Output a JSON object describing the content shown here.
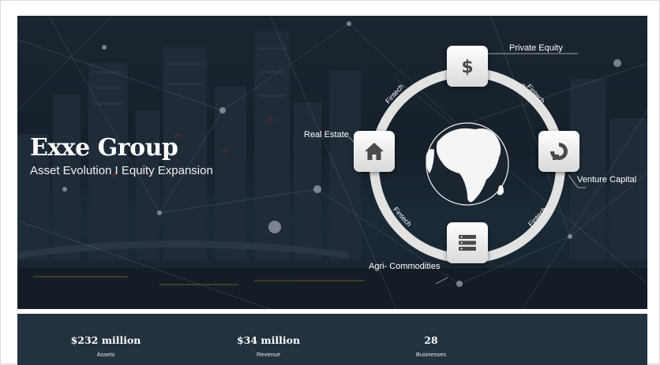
{
  "hero": {
    "title": "Exxe Group",
    "subtitle": "Asset Evolution I Equity Expansion"
  },
  "diagram": {
    "nodes": [
      {
        "label": "Private Equity",
        "icon": "dollar-icon"
      },
      {
        "label": "Venture Capital",
        "icon": "digitalocean-icon"
      },
      {
        "label": "Agri- Commodities",
        "icon": "server-stack-icon"
      },
      {
        "label": "Real Estate",
        "icon": "home-icon"
      }
    ],
    "arc_labels": [
      "Fintech",
      "Fintech",
      "Fintech",
      "Fintech"
    ],
    "center_icon": "globe-africa-icon"
  },
  "stats": [
    {
      "value": "$232 million",
      "label": "Assets"
    },
    {
      "value": "$34 million",
      "label": "Revenue"
    },
    {
      "value": "28",
      "label": "Businesses"
    }
  ],
  "colors": {
    "hero_bg": "#17222d",
    "stats_bg": "#23323f",
    "ring": "#e2e2e2",
    "node_icon": "#4a4a4a"
  }
}
